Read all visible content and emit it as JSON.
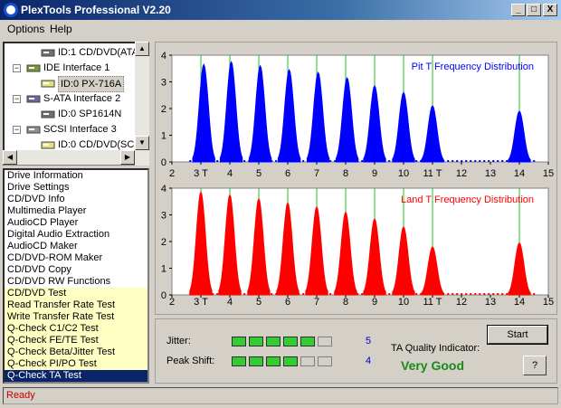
{
  "window": {
    "title": "PlexTools Professional V2.20",
    "minimize": "_",
    "maximize": "□",
    "close": "X"
  },
  "menu": {
    "options": "Options",
    "help": "Help"
  },
  "tree": {
    "items": [
      {
        "label": "ID:1  CD/DVD(ATA",
        "icon": "drive-icon"
      },
      {
        "label": "IDE Interface 1",
        "icon": "ide-interface-icon",
        "expander": "−"
      },
      {
        "label": "ID:0  PX-716A",
        "icon": "cd-drive-icon"
      },
      {
        "label": "S-ATA Interface 2",
        "icon": "sata-interface-icon",
        "expander": "−"
      },
      {
        "label": "ID:0  SP1614N",
        "icon": "hard-drive-icon"
      },
      {
        "label": "SCSI Interface 3",
        "icon": "scsi-interface-icon",
        "expander": "−"
      },
      {
        "label": "ID:0  CD/DVD(SC",
        "icon": "cd-drive-icon"
      }
    ]
  },
  "functions": [
    "Drive Information",
    "Drive Settings",
    "CD/DVD Info",
    "Multimedia Player",
    "AudioCD Player",
    "Digital Audio Extraction",
    "AudioCD Maker",
    "CD/DVD-ROM Maker",
    "CD/DVD Copy",
    "CD/DVD RW Functions",
    "CD/DVD Test",
    "Read Transfer Rate Test",
    "Write Transfer Rate Test",
    "Q-Check C1/C2 Test",
    "Q-Check FE/TE Test",
    "Q-Check Beta/Jitter Test",
    "Q-Check PI/PO Test",
    "Q-Check TA Test"
  ],
  "functions_highlighted_from": 10,
  "functions_selected": 17,
  "chart_data": [
    {
      "type": "area",
      "title": "Pit T Frequency Distribution",
      "color": "#0000ff",
      "xlim": [
        2,
        15
      ],
      "ylim": [
        0,
        4
      ],
      "xticks": [
        "2",
        "3 T",
        "4",
        "5",
        "6",
        "7",
        "8",
        "9",
        "10",
        "11 T",
        "12",
        "13",
        "14",
        "15"
      ],
      "yticks": [
        "0",
        "1",
        "2",
        "3",
        "4"
      ],
      "markers": [
        3,
        4,
        5,
        6,
        7,
        8,
        9,
        10,
        11,
        14
      ],
      "peaks": [
        {
          "center": 3.1,
          "height": 3.65
        },
        {
          "center": 4.05,
          "height": 3.75
        },
        {
          "center": 5.05,
          "height": 3.6
        },
        {
          "center": 6.05,
          "height": 3.45
        },
        {
          "center": 7.05,
          "height": 3.35
        },
        {
          "center": 8.05,
          "height": 3.15
        },
        {
          "center": 9.0,
          "height": 2.85
        },
        {
          "center": 10.0,
          "height": 2.6
        },
        {
          "center": 11.0,
          "height": 2.1
        },
        {
          "center": 14.0,
          "height": 1.9
        }
      ]
    },
    {
      "type": "area",
      "title": "Land T Frequency Distribution",
      "color": "#ff0000",
      "xlim": [
        2,
        15
      ],
      "ylim": [
        0,
        4
      ],
      "xticks": [
        "2",
        "3 T",
        "4",
        "5",
        "6",
        "7",
        "8",
        "9",
        "10",
        "11 T",
        "12",
        "13",
        "14",
        "15"
      ],
      "yticks": [
        "0",
        "1",
        "2",
        "3",
        "4"
      ],
      "markers": [
        3,
        4,
        5,
        6,
        7,
        8,
        9,
        10,
        11,
        14
      ],
      "peaks": [
        {
          "center": 3.0,
          "height": 3.85
        },
        {
          "center": 4.0,
          "height": 3.75
        },
        {
          "center": 5.0,
          "height": 3.6
        },
        {
          "center": 6.0,
          "height": 3.45
        },
        {
          "center": 7.0,
          "height": 3.3
        },
        {
          "center": 8.0,
          "height": 3.1
        },
        {
          "center": 9.0,
          "height": 2.85
        },
        {
          "center": 10.0,
          "height": 2.55
        },
        {
          "center": 11.0,
          "height": 1.8
        },
        {
          "center": 14.0,
          "height": 1.95
        }
      ]
    }
  ],
  "results": {
    "jitter_label": "Jitter:",
    "jitter_value": "5",
    "jitter_level": 5,
    "peak_shift_label": "Peak Shift:",
    "peak_shift_value": "4",
    "peak_shift_level": 4,
    "level_max": 6,
    "quality_label": "TA Quality Indicator:",
    "quality_value": "Very Good",
    "start_label": "Start",
    "help_label": "?"
  },
  "status": "Ready"
}
